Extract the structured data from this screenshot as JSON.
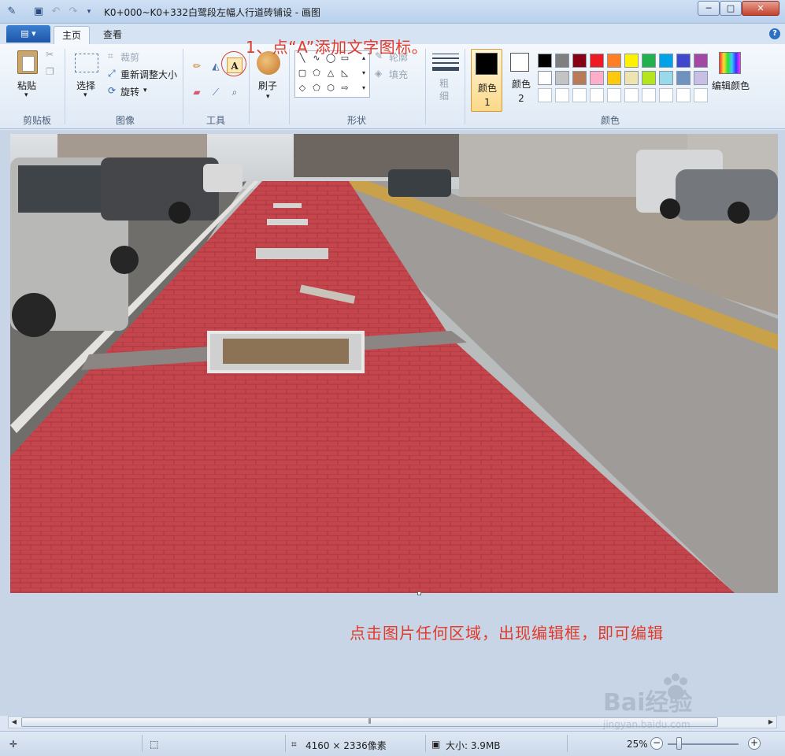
{
  "window": {
    "title": "K0+000~K0+332白鹭段左幅人行道砖铺设 - 画图"
  },
  "quick_access": {
    "app_icon": "paint-app-icon",
    "save_icon": "save-icon",
    "undo_icon": "undo-icon",
    "redo_icon": "redo-icon",
    "customize_icon": "dropdown-icon"
  },
  "window_controls": {
    "minimize": "─",
    "maximize": "□",
    "close": "✕"
  },
  "ribbon_tabs": {
    "file_label": "▤ ▾",
    "tabs": [
      {
        "label": "主页",
        "active": true
      },
      {
        "label": "查看",
        "active": false
      }
    ],
    "help": "?"
  },
  "ribbon": {
    "clipboard": {
      "paste": "粘贴",
      "group": "剪贴板"
    },
    "image": {
      "select": "选择",
      "crop": "裁剪",
      "resize": "重新调整大小",
      "rotate": "旋转",
      "group": "图像"
    },
    "tools": {
      "group": "工具",
      "text_glyph": "A"
    },
    "brushes": {
      "label": "刷子"
    },
    "shapes": {
      "outline": "轮廓",
      "fill": "填充",
      "group": "形状"
    },
    "size": {
      "label": "粗细"
    },
    "colors": {
      "color1_label": "颜色 1",
      "color2_label": "颜色 2",
      "color1": "#000000",
      "color2": "#ffffff",
      "edit_colors": "编辑颜色",
      "group": "颜色",
      "palette_row1": [
        "#000000",
        "#7f7f7f",
        "#880015",
        "#ed1c24",
        "#ff7f27",
        "#fff200",
        "#22b14c",
        "#00a2e8",
        "#3f48cc",
        "#a349a4"
      ],
      "palette_row2": [
        "#ffffff",
        "#c3c3c3",
        "#b97a57",
        "#ffaec9",
        "#ffc90e",
        "#efe4b0",
        "#b5e61d",
        "#99d9ea",
        "#7092be",
        "#c8bfe7"
      ],
      "palette_row3": [
        "#ffffff",
        "#ffffff",
        "#ffffff",
        "#ffffff",
        "#ffffff",
        "#ffffff",
        "#ffffff",
        "#ffffff",
        "#ffffff",
        "#ffffff"
      ]
    }
  },
  "annotations": {
    "step1": "1、点“A”添加文字图标。",
    "hint": "点击图片任何区域，出现编辑框，即可编辑"
  },
  "status": {
    "canvas_size": "4160 × 2336像素",
    "file_size": "大小: 3.9MB",
    "zoom": "25%"
  },
  "watermark": {
    "brand": "Bai经验",
    "url": "jingyan.baidu.com"
  }
}
